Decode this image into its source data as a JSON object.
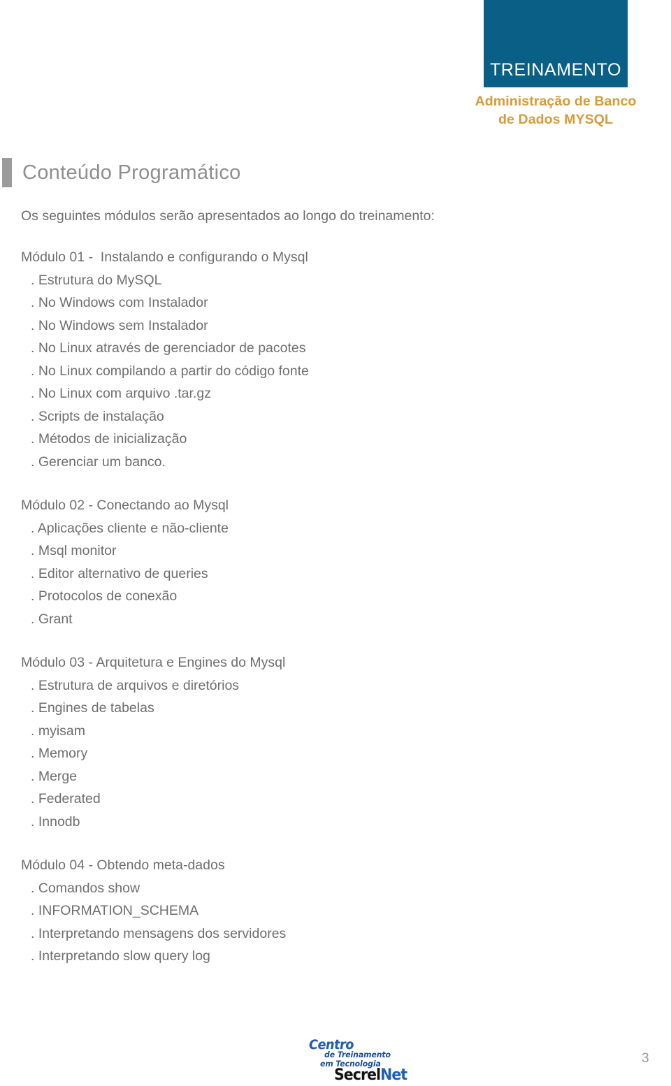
{
  "colors": {
    "header_box_blue": "#0a5f86",
    "course_title_orange": "#d79a37",
    "body_gray": "#6e6e6e",
    "heading_gray": "#8e8e8e",
    "accent_bar_gray": "#9b9b9b",
    "logo_blue": "#1f5fb0"
  },
  "header": {
    "badge_label": "TREINAMENTO",
    "course_title_line1": "Administração de Banco",
    "course_title_line2": "de Dados MYSQL"
  },
  "section": {
    "heading": "Conteúdo Programático",
    "intro": "Os seguintes módulos serão apresentados ao longo do treinamento:"
  },
  "modules": [
    {
      "title": "Módulo 01 -  Instalando e configurando o Mysql",
      "items": [
        ". Estrutura do MySQL",
        ". No Windows com Instalador",
        ". No Windows sem Instalador",
        ". No Linux através de gerenciador de pacotes",
        ". No Linux compilando a partir do código fonte",
        ". No Linux com arquivo .tar.gz",
        ". Scripts de instalação",
        ". Métodos de inicialização",
        ". Gerenciar um banco."
      ]
    },
    {
      "title": "Módulo 02 - Conectando ao Mysql",
      "items": [
        ". Aplicações cliente e não-cliente",
        ". Msql monitor",
        ". Editor alternativo de queries",
        ". Protocolos de conexão",
        ". Grant"
      ]
    },
    {
      "title": "Módulo 03 - Arquitetura e Engines do Mysql",
      "items": [
        ". Estrutura de arquivos e diretórios",
        ". Engines de tabelas",
        ". myisam",
        ". Memory",
        ". Merge",
        ". Federated",
        ". Innodb"
      ]
    },
    {
      "title": "Módulo 04 - Obtendo meta-dados",
      "items": [
        ". Comandos show",
        ". INFORMATION_SCHEMA",
        ". Interpretando mensagens dos servidores",
        ". Interpretando slow query log"
      ]
    }
  ],
  "footer": {
    "logo_line1": "Centro",
    "logo_line2": "de Treinamento",
    "logo_line3": "em Tecnologia",
    "logo_brand_part1": "Secrel",
    "logo_brand_part2": "Net",
    "page_number": "3"
  }
}
